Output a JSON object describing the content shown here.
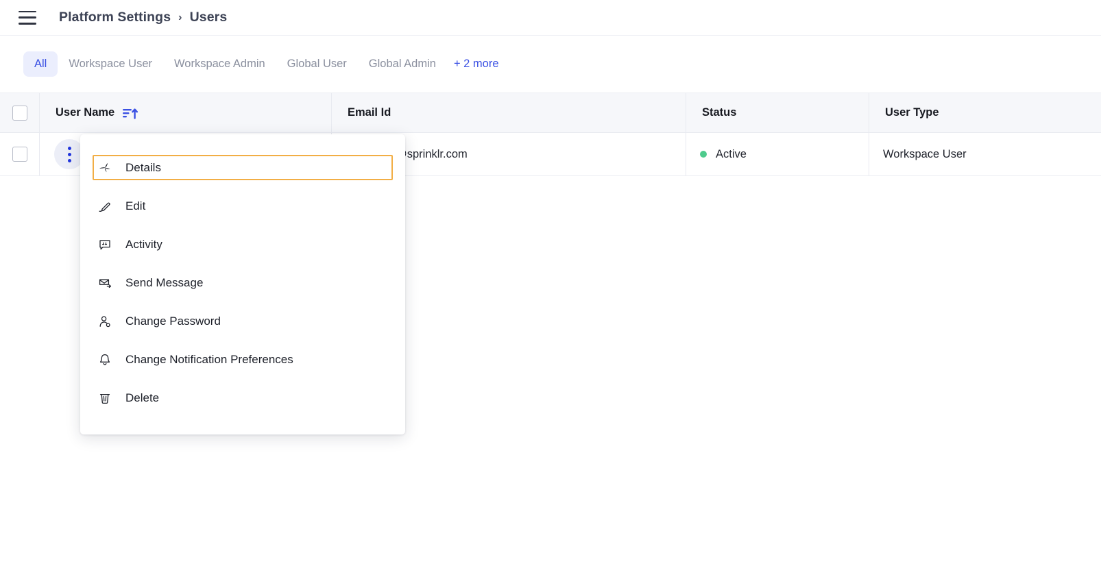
{
  "header": {
    "menu_icon": "hamburger-icon",
    "breadcrumb": {
      "parent": "Platform Settings",
      "separator": "›",
      "current": "Users"
    }
  },
  "tabs": {
    "items": [
      {
        "label": "All",
        "active": true
      },
      {
        "label": "Workspace User",
        "active": false
      },
      {
        "label": "Workspace Admin",
        "active": false
      },
      {
        "label": "Global User",
        "active": false
      },
      {
        "label": "Global Admin",
        "active": false
      }
    ],
    "more_label": "+ 2 more",
    "active_bg": "#EBEEFD",
    "active_color": "#3A50E3",
    "link_color": "#3A50E3"
  },
  "table": {
    "columns": [
      {
        "label": "User Name",
        "sorted": true,
        "sort_icon": "sort-ascending-icon"
      },
      {
        "label": "Email Id",
        "sorted": false
      },
      {
        "label": "Status",
        "sorted": false
      },
      {
        "label": "User Type",
        "sorted": false
      }
    ],
    "rows": [
      {
        "user_name": "",
        "email": "@sprinklr.com",
        "status": "Active",
        "status_color": "#4ECB8D",
        "user_type": "Workspace User",
        "row_menu_icon": "more-options-icon"
      }
    ]
  },
  "context_menu": {
    "highlight_color": "#F2AE45",
    "items": [
      {
        "label": "Details",
        "icon": "sparkle-icon",
        "highlighted": true
      },
      {
        "label": "Edit",
        "icon": "pencil-icon",
        "highlighted": false
      },
      {
        "label": "Activity",
        "icon": "quote-bubble-icon",
        "highlighted": false
      },
      {
        "label": "Send Message",
        "icon": "envelope-send-icon",
        "highlighted": false
      },
      {
        "label": "Change Password",
        "icon": "user-key-icon",
        "highlighted": false
      },
      {
        "label": "Change Notification Preferences",
        "icon": "bell-icon",
        "highlighted": false
      },
      {
        "label": "Delete",
        "icon": "trash-icon",
        "highlighted": false
      }
    ]
  }
}
